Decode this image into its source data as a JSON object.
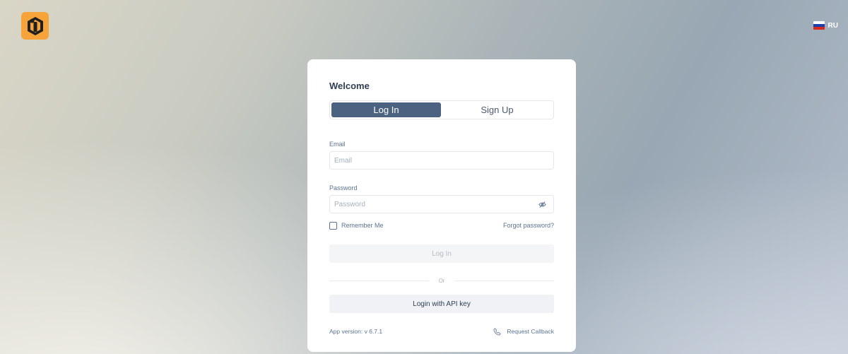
{
  "header": {
    "logo_icon": "brand-logo-icon",
    "language": "RU",
    "flag_colors": [
      "#ffffff",
      "#1c3faa",
      "#d52b1e"
    ]
  },
  "card": {
    "title": "Welcome",
    "tabs": [
      {
        "label": "Log In",
        "active": true
      },
      {
        "label": "Sign Up",
        "active": false
      }
    ],
    "email": {
      "label": "Email",
      "placeholder": "Email",
      "value": ""
    },
    "password": {
      "label": "Password",
      "placeholder": "Password",
      "value": ""
    },
    "remember_label": "Remember Me",
    "forgot_label": "Forgot password?",
    "login_button": "Log In",
    "divider_text": "Or",
    "api_button": "Login with API key",
    "version_text": "App version: v 6.7.1",
    "callback_label": "Request Callback"
  },
  "colors": {
    "accent": "#4b6380",
    "logo_bg": "#f6a33a",
    "label_text": "#5b7392"
  }
}
